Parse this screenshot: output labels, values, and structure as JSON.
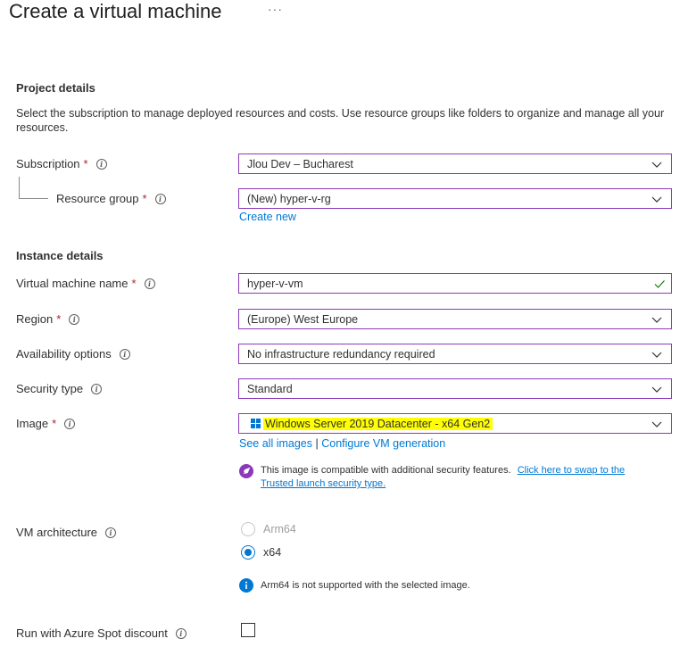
{
  "page": {
    "title": "Create a virtual machine",
    "more": "···"
  },
  "project": {
    "heading": "Project details",
    "description": "Select the subscription to manage deployed resources and costs. Use resource groups like folders to organize and manage all your resources.",
    "subscription": {
      "label": "Subscription",
      "required": "*",
      "value": "Jlou Dev – Bucharest"
    },
    "resource_group": {
      "label": "Resource group",
      "required": "*",
      "value": "(New) hyper-v-rg",
      "create_new": "Create new"
    }
  },
  "instance": {
    "heading": "Instance details",
    "vm_name": {
      "label": "Virtual machine name",
      "required": "*",
      "value": "hyper-v-vm"
    },
    "region": {
      "label": "Region",
      "required": "*",
      "value": "(Europe) West Europe"
    },
    "availability": {
      "label": "Availability options",
      "value": "No infrastructure redundancy required"
    },
    "security_type": {
      "label": "Security type",
      "value": "Standard"
    },
    "image": {
      "label": "Image",
      "required": "*",
      "value": "Windows Server 2019 Datacenter - x64 Gen2",
      "see_all": "See all images",
      "separator": "|",
      "configure": "Configure VM generation",
      "notice_text": "This image is compatible with additional security features.",
      "notice_link_1": "Click here to swap to the",
      "notice_link_2": "Trusted launch security type."
    },
    "vm_architecture": {
      "label": "VM architecture",
      "options": [
        "Arm64",
        "x64"
      ],
      "selected": "x64",
      "info_text": "Arm64 is not supported with the selected image."
    },
    "spot": {
      "label": "Run with Azure Spot discount",
      "checked": false
    }
  },
  "icons": {
    "info": "info-circle-icon",
    "dropdown": "chevron-down-icon",
    "valid": "checkmark-icon",
    "windows": "windows-logo-icon",
    "rocket": "rocket-icon",
    "info_filled": "info-filled-icon"
  },
  "colors": {
    "border_accent": "#8a3ab9",
    "link": "#0078d4",
    "required": "#a4262c",
    "highlight": "#ffff00",
    "valid_check": "#107c10"
  }
}
